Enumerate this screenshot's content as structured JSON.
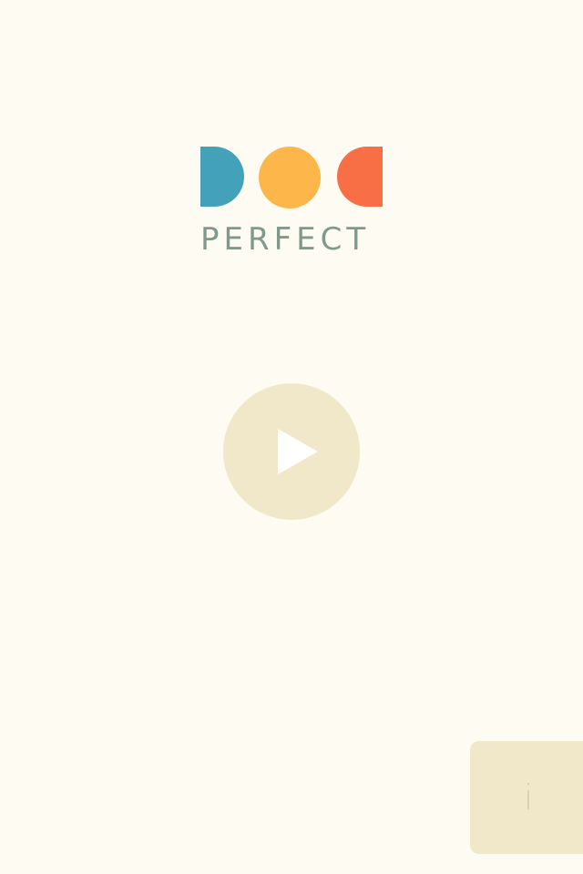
{
  "logo": {
    "title": "PERFECT",
    "colors": {
      "blue": "#43a1b9",
      "yellow": "#fdb64a",
      "orange": "#f86f45"
    }
  },
  "play": {
    "icon": "play-icon",
    "color": "#f0e8c8"
  },
  "info": {
    "icon": "info-icon",
    "glyph": "i"
  }
}
